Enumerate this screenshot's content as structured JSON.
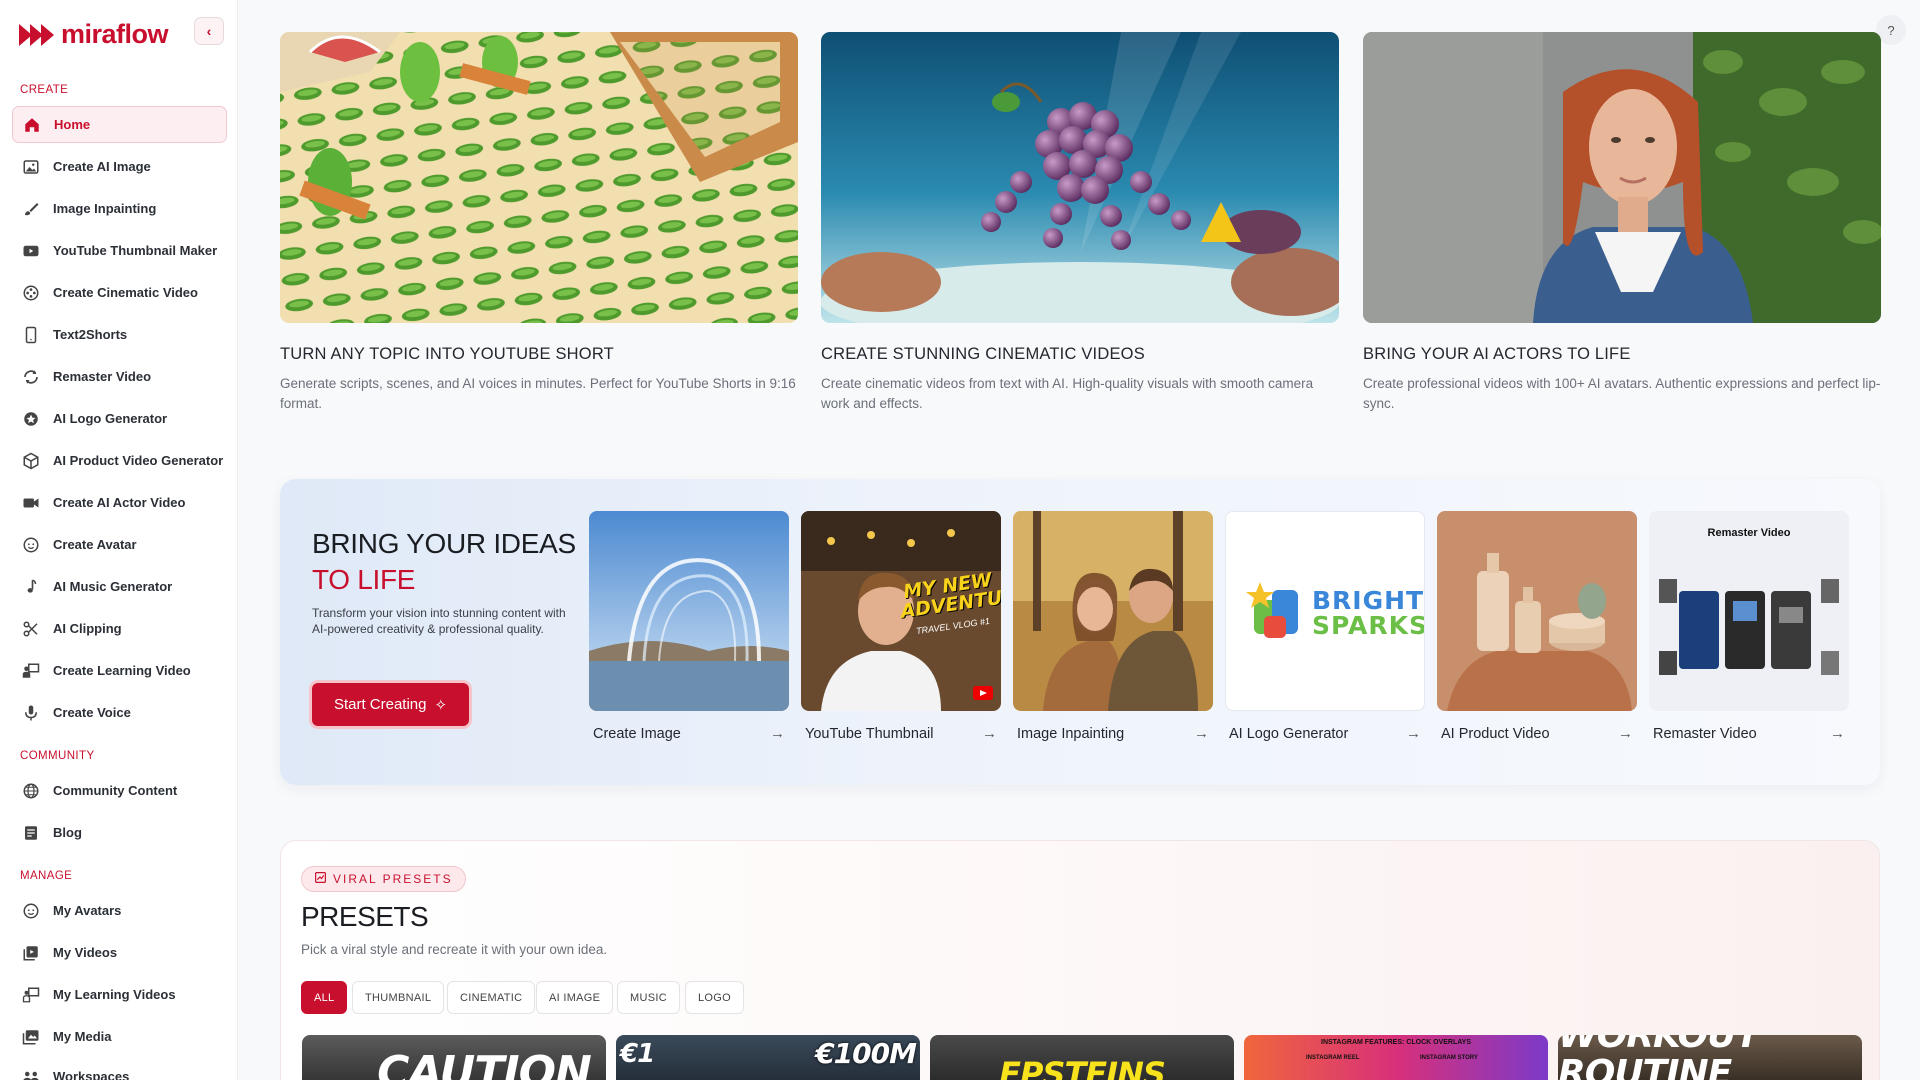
{
  "brand": {
    "name": "miraflow"
  },
  "sidebar": {
    "sections": {
      "create": "CREATE",
      "community": "COMMUNITY",
      "manage": "MANAGE"
    },
    "create_items": [
      {
        "label": "Home",
        "icon": "home-icon"
      },
      {
        "label": "Create AI Image",
        "icon": "image-icon"
      },
      {
        "label": "Image Inpainting",
        "icon": "brush-icon"
      },
      {
        "label": "YouTube Thumbnail Maker",
        "icon": "youtube-icon"
      },
      {
        "label": "Create Cinematic Video",
        "icon": "film-reel-icon"
      },
      {
        "label": "Text2Shorts",
        "icon": "phone-icon"
      },
      {
        "label": "Remaster Video",
        "icon": "refresh-icon"
      },
      {
        "label": "AI Logo Generator",
        "icon": "star-badge-icon"
      },
      {
        "label": "AI Product Video Generator",
        "icon": "box-icon"
      },
      {
        "label": "Create AI Actor Video",
        "icon": "video-camera-icon"
      },
      {
        "label": "Create Avatar",
        "icon": "face-icon"
      },
      {
        "label": "AI Music Generator",
        "icon": "music-note-icon"
      },
      {
        "label": "AI Clipping",
        "icon": "scissors-icon"
      },
      {
        "label": "Create Learning Video",
        "icon": "teacher-icon"
      },
      {
        "label": "Create Voice",
        "icon": "microphone-icon"
      }
    ],
    "community_items": [
      {
        "label": "Community Content",
        "icon": "globe-icon"
      },
      {
        "label": "Blog",
        "icon": "blog-icon"
      }
    ],
    "manage_items": [
      {
        "label": "My Avatars",
        "icon": "face-icon"
      },
      {
        "label": "My Videos",
        "icon": "video-library-icon"
      },
      {
        "label": "My Learning Videos",
        "icon": "learning-icon"
      },
      {
        "label": "My Media",
        "icon": "media-icon"
      },
      {
        "label": "Workspaces",
        "icon": "workspaces-icon"
      }
    ]
  },
  "help": {
    "label": "?"
  },
  "hero_cards": [
    {
      "title": "TURN ANY TOPIC INTO YOUTUBE SHORT",
      "desc": "Generate scripts, scenes, and AI voices in minutes. Perfect for YouTube Shorts in 9:16 format."
    },
    {
      "title": "CREATE STUNNING CINEMATIC VIDEOS",
      "desc": "Create cinematic videos from text with AI. High-quality visuals with smooth camera work and effects."
    },
    {
      "title": "BRING YOUR AI ACTORS TO LIFE",
      "desc": "Create professional videos with 100+ AI avatars. Authentic expressions and perfect lip-sync."
    }
  ],
  "ideas": {
    "title_line1": "BRING YOUR IDEAS",
    "title_line2": "TO LIFE",
    "desc": "Transform your vision into stunning content with AI-powered creativity & professional quality.",
    "cta": "Start Creating",
    "tools": [
      {
        "label": "Create Image"
      },
      {
        "label": "YouTube Thumbnail",
        "overlay": "MY NEW ADVENTURE!",
        "overlay_sub": "TRAVEL VLOG #1"
      },
      {
        "label": "Image Inpainting"
      },
      {
        "label": "AI Logo Generator",
        "logo_line1": "BRIGHT",
        "logo_line2": "SPARKS"
      },
      {
        "label": "AI Product Video"
      },
      {
        "label": "Remaster Video",
        "banner": "Remaster Video"
      }
    ]
  },
  "presets": {
    "badge": "VIRAL PRESETS",
    "title": "PRESETS",
    "subtitle": "Pick a viral style and recreate it with your own idea.",
    "filters": [
      "ALL",
      "THUMBNAIL",
      "CINEMATIC",
      "AI IMAGE",
      "MUSIC",
      "LOGO"
    ],
    "active_filter": "ALL",
    "thumbs": [
      {
        "text": "CAUTION"
      },
      {
        "text": "€100M",
        "text2": "€1"
      },
      {
        "text": "EPSTEINS"
      },
      {
        "text": "INSTAGRAM FEATURES: CLOCK OVERLAYS",
        "text2": "INSTAGRAM REEL",
        "text3": "INSTAGRAM STORY"
      },
      {
        "text": "WORKOUT ROUTINE"
      }
    ]
  },
  "colors": {
    "accent": "#c8102e",
    "accent_soft": "#fdeff1"
  }
}
